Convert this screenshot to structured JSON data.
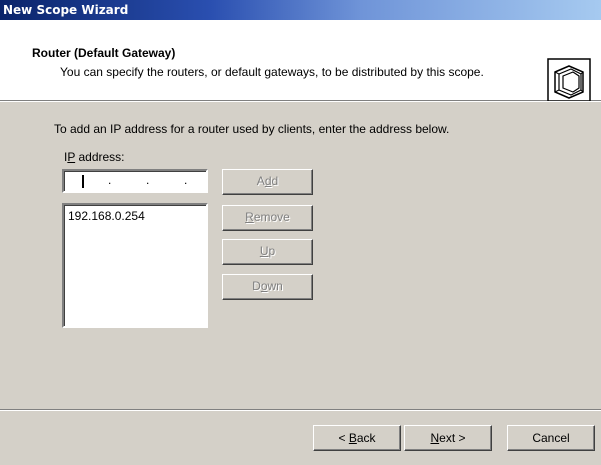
{
  "window": {
    "title": "New Scope Wizard",
    "colors": {
      "titlebar_start": "#0a246a",
      "titlebar_end": "#a6caf0",
      "face": "#d4d0c8"
    }
  },
  "header": {
    "title": "Router (Default Gateway)",
    "subtitle": "You can specify the routers, or default gateways, to be distributed by this scope.",
    "icon": "wizard-pages-icon"
  },
  "body": {
    "instruction": "To add an IP address for a router used by clients, enter the address below.",
    "ip_label_prefix": "I",
    "ip_label_accel": "P",
    "ip_label_suffix": " address:",
    "ip_input_value": "",
    "ip_list": [
      "192.168.0.254"
    ]
  },
  "buttons": {
    "add": {
      "pre": "A",
      "accel": "d",
      "post": "d",
      "enabled": false
    },
    "remove": {
      "pre": "",
      "accel": "R",
      "post": "emove",
      "enabled": false
    },
    "up": {
      "pre": "",
      "accel": "U",
      "post": "p",
      "enabled": false
    },
    "down": {
      "pre": "D",
      "accel": "o",
      "post": "wn",
      "enabled": false
    }
  },
  "footer": {
    "back": {
      "pre": "< ",
      "accel": "B",
      "post": "ack"
    },
    "next": {
      "pre": "",
      "accel": "N",
      "post": "ext >"
    },
    "cancel": {
      "label": "Cancel"
    }
  }
}
